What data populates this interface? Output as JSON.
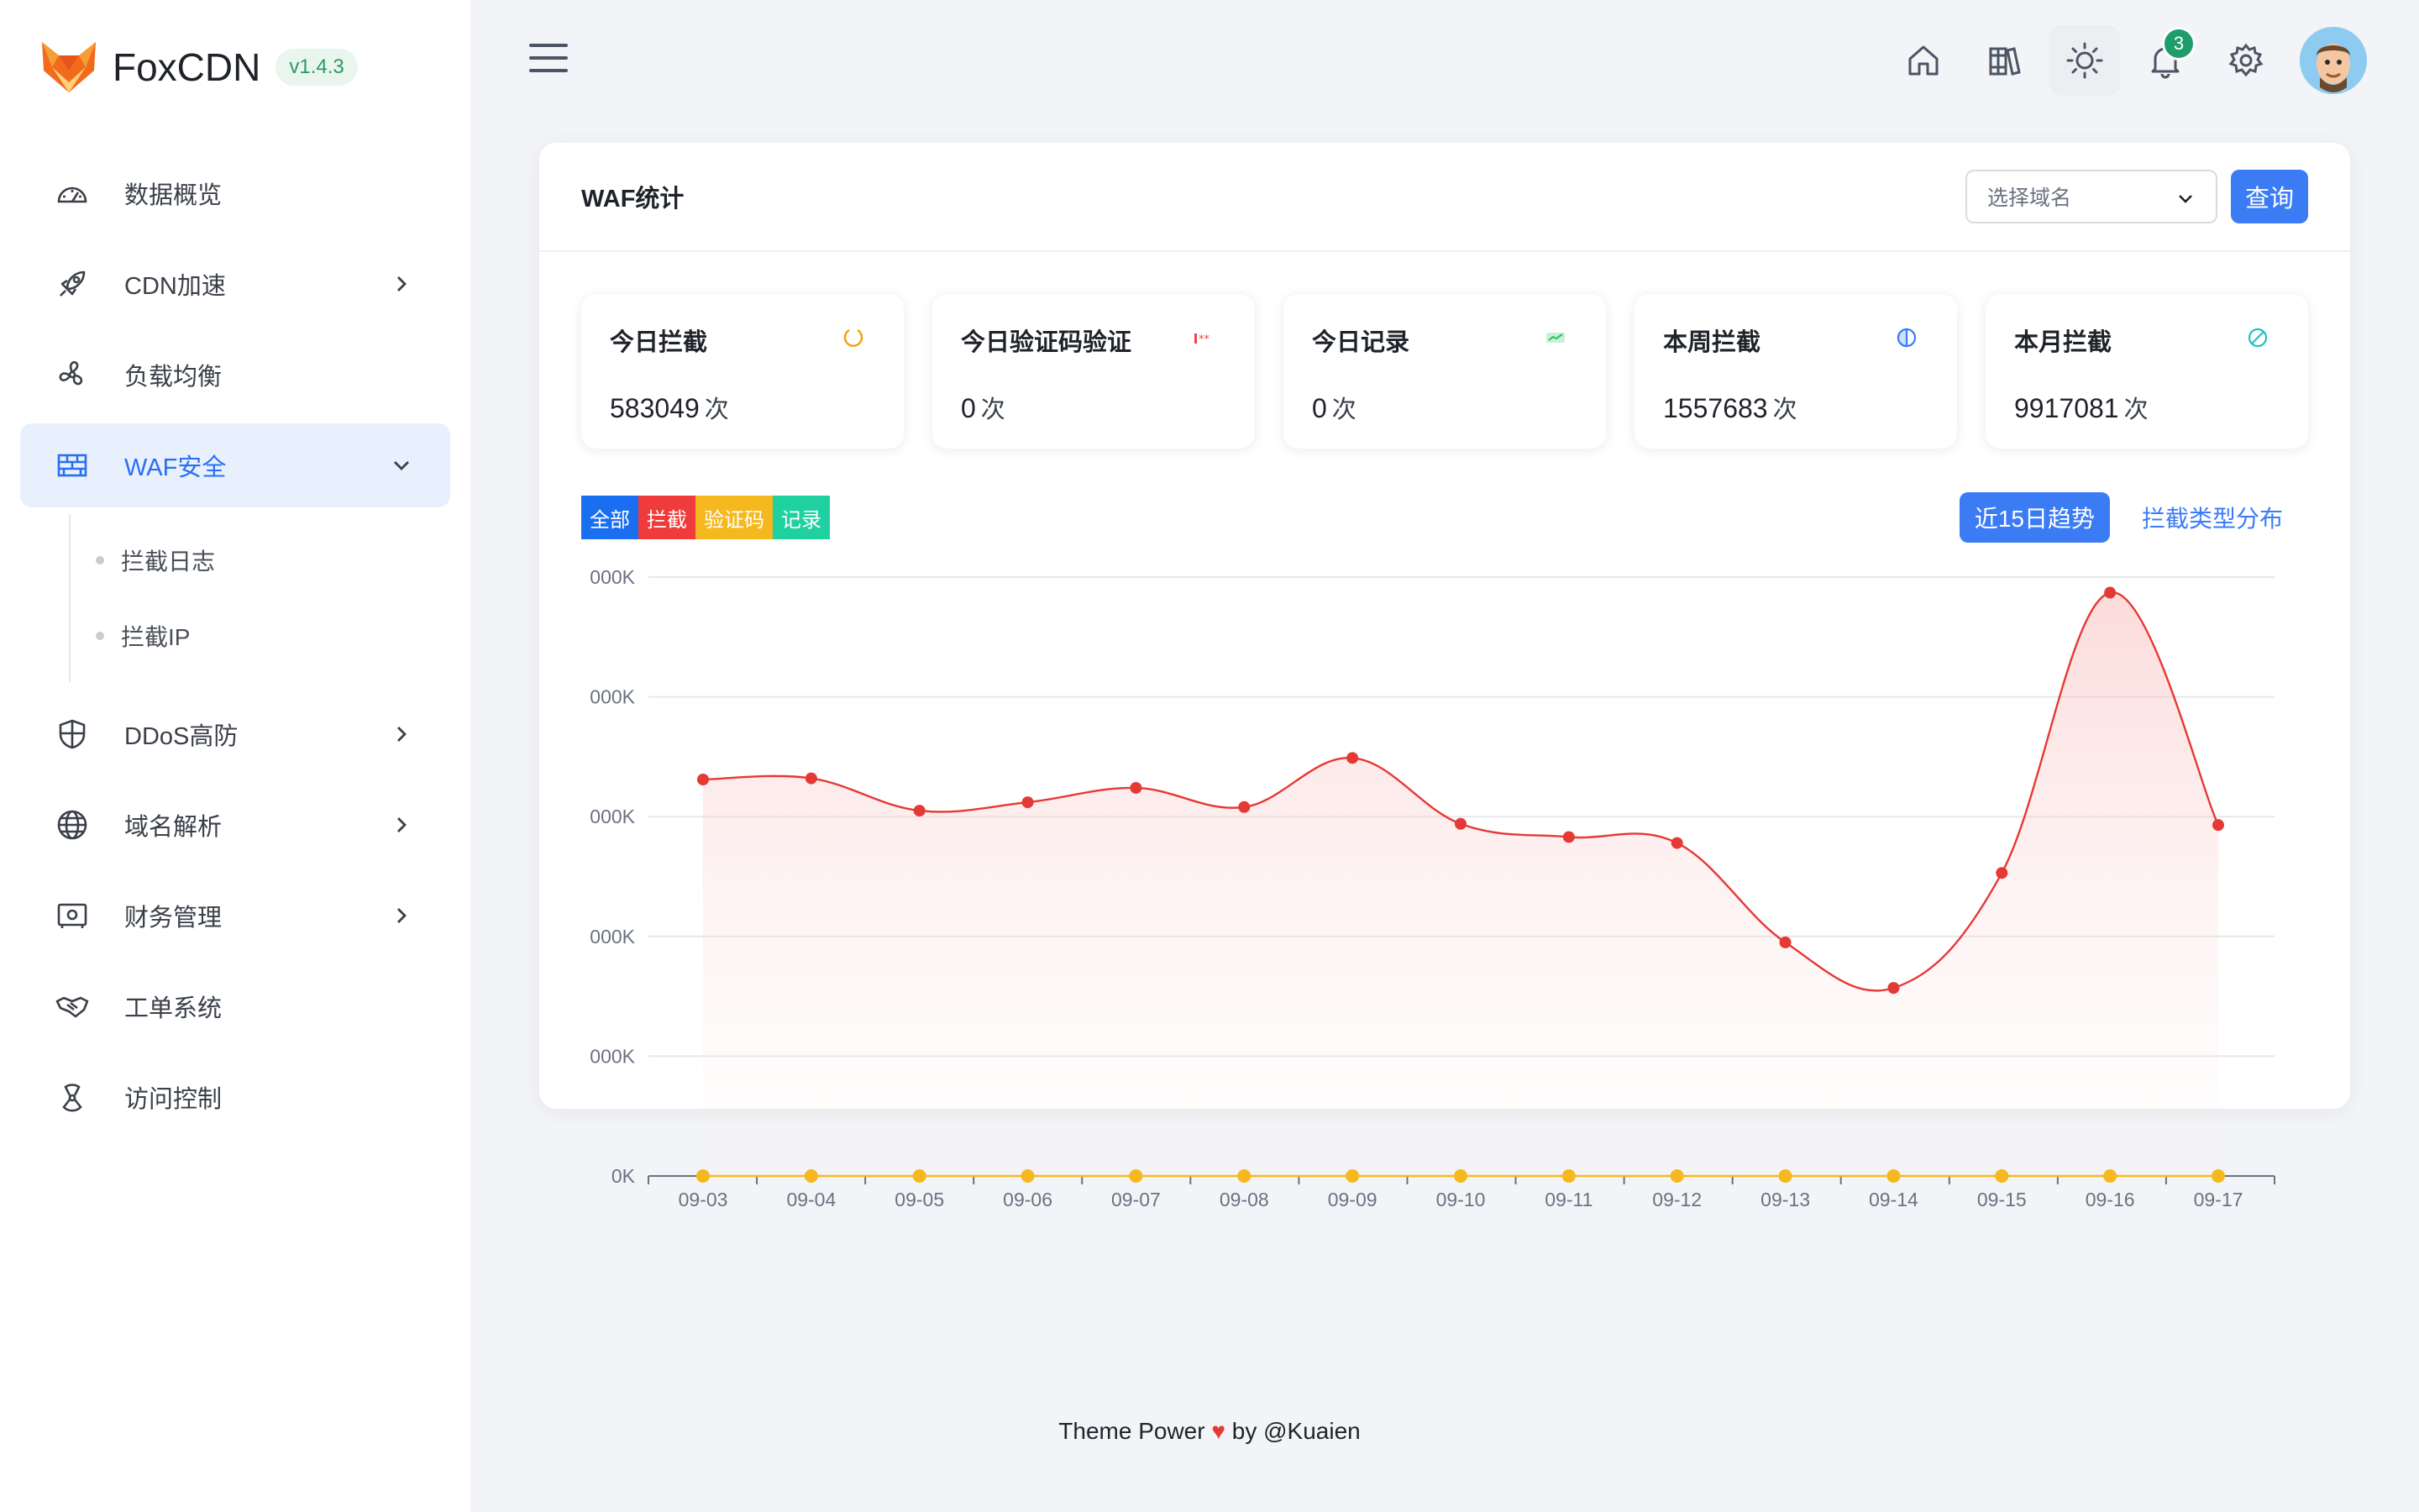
{
  "brand": {
    "name": "FoxCDN",
    "version": "v1.4.3"
  },
  "sidebar": {
    "items": [
      {
        "label": "数据概览",
        "icon": "dashboard-icon",
        "has_children": false
      },
      {
        "label": "CDN加速",
        "icon": "rocket-icon",
        "has_children": true
      },
      {
        "label": "负载均衡",
        "icon": "fan-icon",
        "has_children": false
      },
      {
        "label": "WAF安全",
        "icon": "firewall-icon",
        "has_children": true,
        "active": true,
        "expanded": true
      },
      {
        "label": "DDoS高防",
        "icon": "shield-icon",
        "has_children": true
      },
      {
        "label": "域名解析",
        "icon": "globe-icon",
        "has_children": true
      },
      {
        "label": "财务管理",
        "icon": "safe-icon",
        "has_children": true
      },
      {
        "label": "工单系统",
        "icon": "handshake-icon",
        "has_children": false
      },
      {
        "label": "访问控制",
        "icon": "radiation-icon",
        "has_children": false
      }
    ],
    "waf_submenu": [
      {
        "label": "拦截日志"
      },
      {
        "label": "拦截IP"
      }
    ]
  },
  "topbar": {
    "icons": [
      "menu-icon",
      "home-icon",
      "books-icon",
      "sun-icon",
      "bell-icon",
      "gear-icon"
    ],
    "notification_count": "3"
  },
  "card": {
    "title": "WAF统计",
    "domain_select": {
      "placeholder": "选择域名"
    },
    "query_label": "查询"
  },
  "stats": [
    {
      "title": "今日拦截",
      "value": "583049",
      "unit": "次",
      "icon": "spinner-icon",
      "color": "#f59e0b"
    },
    {
      "title": "今日验证码验证",
      "value": "0",
      "unit": "次",
      "icon": "captcha-icon",
      "color": "#ef4444"
    },
    {
      "title": "今日记录",
      "value": "0",
      "unit": "次",
      "icon": "check-chart-icon",
      "color": "#22c55e"
    },
    {
      "title": "本周拦截",
      "value": "1557683",
      "unit": "次",
      "icon": "half-circle-icon",
      "color": "#3b7cf5"
    },
    {
      "title": "本月拦截",
      "value": "9917081",
      "unit": "次",
      "icon": "ban-icon",
      "color": "#22c1c3"
    }
  ],
  "legend": [
    {
      "label": "全部",
      "color": "#1a6ff0"
    },
    {
      "label": "拦截",
      "color": "#ef3b3b"
    },
    {
      "label": "验证码",
      "color": "#f5b81f"
    },
    {
      "label": "记录",
      "color": "#1fd1a0"
    }
  ],
  "tabs": {
    "active": "近15日趋势",
    "other": "拦截类型分布"
  },
  "chart_data": {
    "type": "line",
    "categories": [
      "09-03",
      "09-04",
      "09-05",
      "09-06",
      "09-07",
      "09-08",
      "09-09",
      "09-10",
      "09-11",
      "09-12",
      "09-13",
      "09-14",
      "09-15",
      "09-16",
      "09-17"
    ],
    "y_ticks": [
      "0K",
      "000K",
      "000K",
      "000K",
      "000K",
      "000K"
    ],
    "ylim": [
      0,
      5
    ],
    "series": [
      {
        "name": "拦截",
        "color": "#e53935",
        "values": [
          3.31,
          3.32,
          3.05,
          3.12,
          3.24,
          3.08,
          3.49,
          2.94,
          2.83,
          2.78,
          1.95,
          1.57,
          2.53,
          4.87,
          2.93
        ]
      },
      {
        "name": "验证码",
        "color": "#f5b81f",
        "values": [
          0,
          0,
          0,
          0,
          0,
          0,
          0,
          0,
          0,
          0,
          0,
          0,
          0,
          0,
          0
        ]
      }
    ],
    "grid": true
  },
  "footer": {
    "left": "Theme Power",
    "heart": "♥",
    "right": "by @Kuaien"
  }
}
